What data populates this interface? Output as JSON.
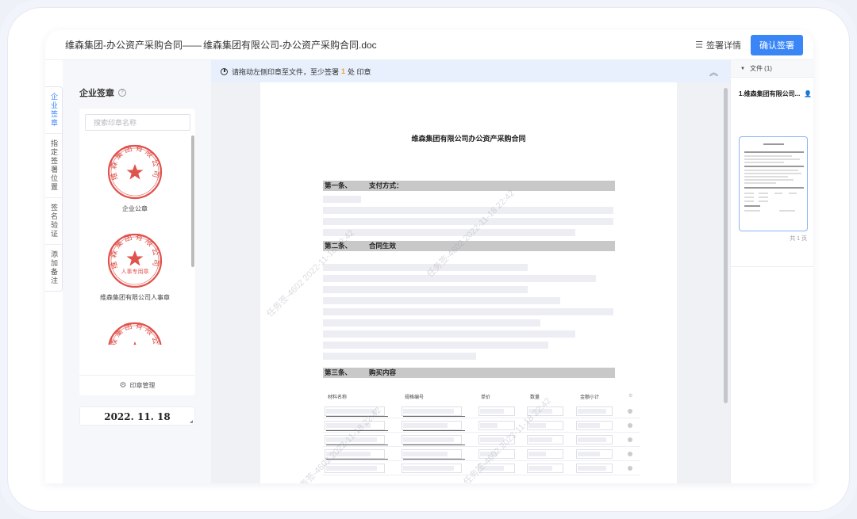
{
  "header": {
    "title": "维森集团-办公资产采购合同——",
    "filename": "维森集团有限公司-办公资产采购合同.doc",
    "detail_label": "签署详情",
    "confirm_label": "确认签署"
  },
  "tabs": [
    {
      "label": "企业签章",
      "active": true
    },
    {
      "label": "指定签署位置",
      "active": false
    },
    {
      "label": "签名验证",
      "active": false
    },
    {
      "label": "添加备注",
      "active": false
    }
  ],
  "seal_panel": {
    "title": "企业签章",
    "search_placeholder": "搜索印章名称",
    "seals": [
      {
        "ring_text": "维森集团有限公司",
        "bottom_text": "",
        "label": "企业公章"
      },
      {
        "ring_text": "维森集团有限公司",
        "bottom_text": "人事专用章",
        "label": "维森集团有限公司人事章"
      },
      {
        "ring_text": "维森集团有限公司",
        "bottom_text": "",
        "label": ""
      }
    ],
    "manage_label": "印章管理",
    "date_stamp": "2022. 11. 18"
  },
  "notice": {
    "prefix": "请拖动左侧印章至文件，至少签署",
    "count": "1",
    "suffix": "处 印章"
  },
  "document": {
    "title": "维森集团有限公司办公资产采购合同",
    "sections": [
      {
        "num": "第一条、",
        "title": "支付方式："
      },
      {
        "num": "第二条、",
        "title": "合同生效"
      },
      {
        "num": "第三条、",
        "title": "购买内容"
      }
    ],
    "watermark": "任务签-4602 2022-11-18 22:42",
    "table_headers": [
      "材料名称",
      "规格编号",
      "单价",
      "数量",
      "金额小计"
    ]
  },
  "files": {
    "header": "文件 (1)",
    "file_name": "1.维森集团有限公司...",
    "page_count": "共 1 页"
  },
  "colors": {
    "accent": "#3a86f7",
    "seal_red": "#e0524c",
    "notice_bg": "#e8f0fd",
    "notice_count": "#f0a030"
  }
}
